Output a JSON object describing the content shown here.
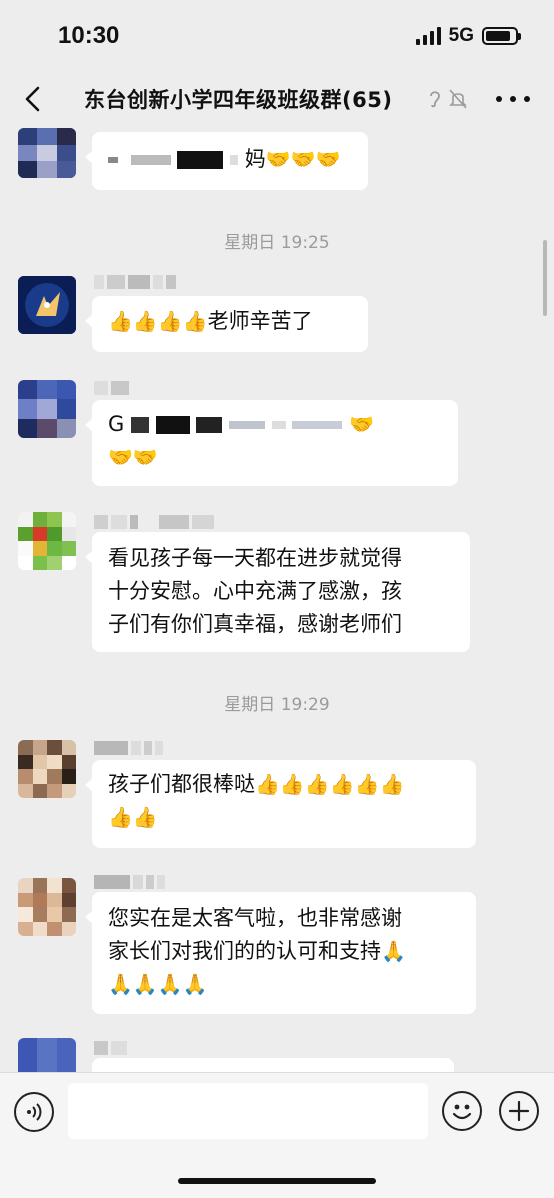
{
  "status_bar": {
    "time": "10:30",
    "network": "5G",
    "battery_level": 0.85
  },
  "nav": {
    "title": "东台创新小学四年级班级群(65)",
    "back_icon": "chevron-left-icon",
    "more_icon": "more-dots-icon"
  },
  "timestamps": [
    "星期日 19:25",
    "星期日 19:29"
  ],
  "messages": [
    {
      "partial_text": "妈",
      "emoji": [
        "🤝",
        "🤝",
        "🤝"
      ]
    },
    {
      "emoji": [
        "👍",
        "👍",
        "👍",
        "👍"
      ],
      "text": "老师辛苦了"
    },
    {
      "partial_text": "G",
      "emoji": [
        "🤝",
        "🤝",
        "🤝"
      ]
    },
    {
      "lines": [
        "看见孩子每一天都在进步就觉得",
        "十分安慰。心中充满了感激，孩",
        "子们有你们真幸福，感谢老师们"
      ]
    },
    {
      "text": "孩子们都很棒哒",
      "emoji_line1": [
        "👍",
        "👍",
        "👍",
        "👍",
        "👍",
        "👍"
      ],
      "emoji_line2": [
        "👍",
        "👍"
      ]
    },
    {
      "line1": "您实在是太客气啦，也非常感谢",
      "line2": "家长们对我们的的认可和支持",
      "emoji_line2": [
        "🙏"
      ],
      "emoji_line3": [
        "🙏",
        "🙏",
        "🙏",
        "🙏"
      ]
    }
  ],
  "input_bar": {
    "placeholder": ""
  },
  "colors": {
    "background": "#ededed",
    "bubble": "#ffffff",
    "timestamp": "#9b9b9b"
  }
}
